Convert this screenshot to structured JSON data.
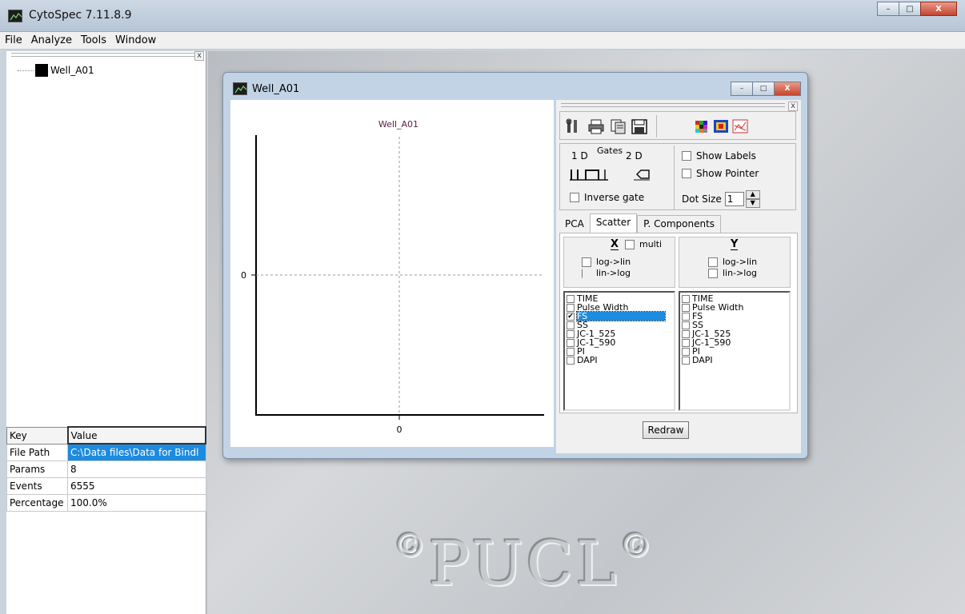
{
  "app": {
    "title": "CytoSpec  7.11.8.9"
  },
  "menu": [
    "File",
    "Analyze",
    "Tools",
    "Window"
  ],
  "tree": {
    "items": [
      {
        "label": "Well_A01"
      }
    ]
  },
  "properties": {
    "headers": {
      "key": "Key",
      "value": "Value"
    },
    "rows": [
      {
        "key": "File Path",
        "value": "C:\\Data files\\Data for Bindl"
      },
      {
        "key": "Params",
        "value": "8"
      },
      {
        "key": "Events",
        "value": "6555"
      },
      {
        "key": "Percentage",
        "value": "100.0%"
      }
    ]
  },
  "child_window": {
    "title": "Well_A01"
  },
  "plot": {
    "title": "Well_A01",
    "x_tick": "0",
    "y_tick": "0"
  },
  "toolbar": {
    "icons": [
      "tools-icon",
      "print-icon",
      "copy-icon",
      "save-icon",
      "color-grid-icon",
      "heatmap-icon",
      "chart-icon"
    ]
  },
  "gates": {
    "label": "Gates",
    "one_d": "1 D",
    "two_d": "2 D",
    "inverse_gate": "Inverse gate"
  },
  "display": {
    "show_labels": "Show Labels",
    "show_pointer": "Show Pointer",
    "dot_size_label": "Dot Size",
    "dot_size_value": "1"
  },
  "tabs": [
    {
      "label": "PCA",
      "active": false
    },
    {
      "label": "Scatter",
      "active": true
    },
    {
      "label": "P. Components",
      "active": false
    }
  ],
  "scatter": {
    "x_label": "X",
    "multi": "multi",
    "y_label": "Y",
    "log_to_lin": "log->lin",
    "lin_to_log": "lin->log",
    "x_params": [
      {
        "name": "TIME",
        "checked": false
      },
      {
        "name": "Pulse Width",
        "checked": false
      },
      {
        "name": "FS",
        "checked": true
      },
      {
        "name": "SS",
        "checked": false
      },
      {
        "name": "JC-1_525",
        "checked": false
      },
      {
        "name": "JC-1_590",
        "checked": false
      },
      {
        "name": "PI",
        "checked": false
      },
      {
        "name": "DAPI",
        "checked": false
      }
    ],
    "y_params": [
      {
        "name": "TIME",
        "checked": false
      },
      {
        "name": "Pulse Width",
        "checked": false
      },
      {
        "name": "FS",
        "checked": false
      },
      {
        "name": "SS",
        "checked": false
      },
      {
        "name": "JC-1_525",
        "checked": false
      },
      {
        "name": "JC-1_590",
        "checked": false
      },
      {
        "name": "PI",
        "checked": false
      },
      {
        "name": "DAPI",
        "checked": false
      }
    ]
  },
  "redraw_label": "Redraw",
  "background_logo": "PUCL",
  "window_buttons": {
    "minimize": "–",
    "maximize": "□",
    "close": "X"
  }
}
